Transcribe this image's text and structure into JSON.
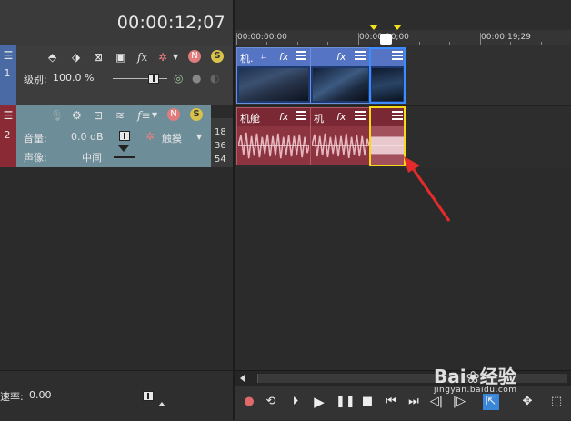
{
  "timecode": "00:00:12;07",
  "ruler": {
    "labels": [
      "00:00:00;00",
      "00:00:10;00",
      "00:00:19;29"
    ]
  },
  "video_track": {
    "number": "1",
    "level_label": "级别:",
    "level_value": "100.0 %",
    "icons": [
      "composite-mode-icon",
      "parent-motion-icon",
      "mute-icon",
      "track-motion-icon",
      "fx-icon",
      "settings-icon",
      "bypass-icon",
      "solo-icon"
    ]
  },
  "audio_track": {
    "number": "2",
    "volume_label": "音量:",
    "volume_value": "0.0 dB",
    "pan_label": "声像:",
    "pan_value": "中间",
    "touch_label": "触摸",
    "meter_ticks": [
      "18",
      "36",
      "54"
    ]
  },
  "video_clips": [
    {
      "title": "机.",
      "state": "normal"
    },
    {
      "title": "",
      "state": "normal"
    },
    {
      "title": "",
      "state": "selected"
    }
  ],
  "audio_clips": [
    {
      "title": "机舱",
      "state": "normal"
    },
    {
      "title": "机",
      "state": "normal"
    },
    {
      "title": "",
      "state": "selected"
    }
  ],
  "rate": {
    "label": "速率:",
    "value": "0.00"
  },
  "transport_buttons": [
    "record-icon",
    "loop-icon",
    "play-from-start-icon",
    "play-icon",
    "pause-icon",
    "stop-icon",
    "prev-frame-icon",
    "next-frame-icon",
    "prev-marker-icon",
    "next-marker-icon",
    "normal-edit-tool-icon",
    "envelope-tool-icon",
    "selection-tool-icon"
  ],
  "watermark": {
    "brand": "Bai",
    "brand2": "经验",
    "url": "jingyan.baidu.com"
  },
  "colors": {
    "video_clip_title": "#5574c4",
    "audio_clip": "#8d3441",
    "selection_video": "#3a8cff",
    "selection_audio": "#f5d91a",
    "arrow": "#e32b2b"
  }
}
